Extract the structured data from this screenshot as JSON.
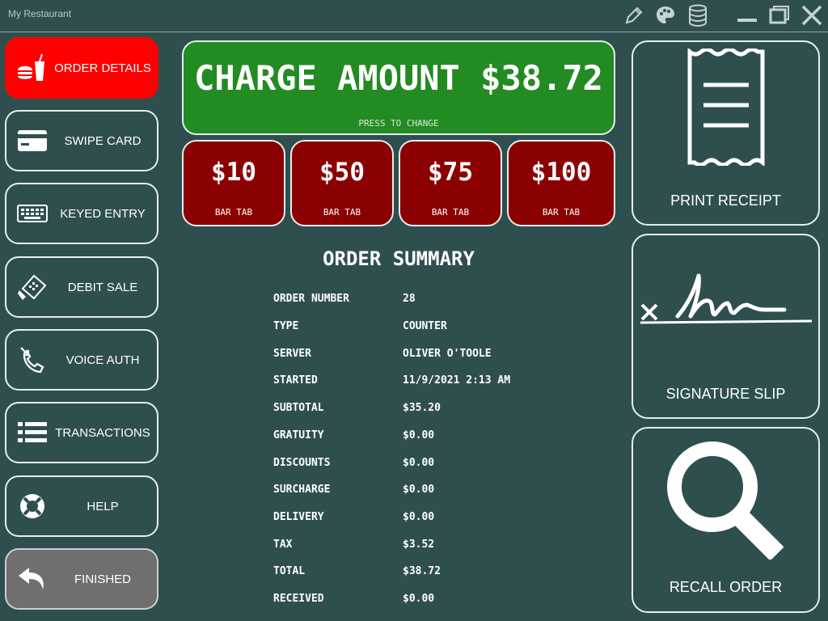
{
  "app": {
    "title": "My Restaurant"
  },
  "titlebar_icons": [
    "pencil-icon",
    "palette-icon",
    "database-icon",
    "minimize-icon",
    "maximize-icon",
    "close-icon"
  ],
  "sidebar": {
    "items": [
      {
        "label": "ORDER DETAILS",
        "icon": "food-drink-icon",
        "active": true
      },
      {
        "label": "SWIPE CARD",
        "icon": "credit-card-icon"
      },
      {
        "label": "KEYED ENTRY",
        "icon": "keyboard-icon"
      },
      {
        "label": "DEBIT SALE",
        "icon": "card-terminal-icon"
      },
      {
        "label": "VOICE AUTH",
        "icon": "phone-icon"
      },
      {
        "label": "TRANSACTIONS",
        "icon": "list-icon"
      },
      {
        "label": "HELP",
        "icon": "lifebuoy-icon"
      },
      {
        "label": "FINISHED",
        "icon": "return-arrow-icon"
      }
    ]
  },
  "charge": {
    "label": "CHARGE AMOUNT $38.72",
    "sub": "PRESS TO CHANGE"
  },
  "bar_tabs": [
    {
      "value": "$10",
      "label": "BAR TAB"
    },
    {
      "value": "$50",
      "label": "BAR TAB"
    },
    {
      "value": "$75",
      "label": "BAR TAB"
    },
    {
      "value": "$100",
      "label": "BAR TAB"
    }
  ],
  "summary": {
    "title": "ORDER SUMMARY",
    "rows": [
      {
        "key": "ORDER NUMBER",
        "value": "28"
      },
      {
        "key": "TYPE",
        "value": "COUNTER"
      },
      {
        "key": "SERVER",
        "value": "OLIVER O'TOOLE"
      },
      {
        "key": "STARTED",
        "value": "11/9/2021 2:13 AM"
      },
      {
        "key": "SUBTOTAL",
        "value": "$35.20"
      },
      {
        "key": "GRATUITY",
        "value": "$0.00"
      },
      {
        "key": "DISCOUNTS",
        "value": "$0.00"
      },
      {
        "key": "SURCHARGE",
        "value": "$0.00"
      },
      {
        "key": "DELIVERY",
        "value": "$0.00"
      },
      {
        "key": "TAX",
        "value": "$3.52"
      },
      {
        "key": "TOTAL",
        "value": "$38.72"
      },
      {
        "key": "RECEIVED",
        "value": "$0.00"
      }
    ]
  },
  "actions": {
    "print_receipt": "PRINT RECEIPT",
    "signature_slip": "SIGNATURE SLIP",
    "recall_order": "RECALL ORDER"
  },
  "colors": {
    "background": "#2f4f4f",
    "active": "#ff0000",
    "charge": "#228b22",
    "bar_tab": "#8b0000",
    "finished": "#6f6f6f"
  }
}
